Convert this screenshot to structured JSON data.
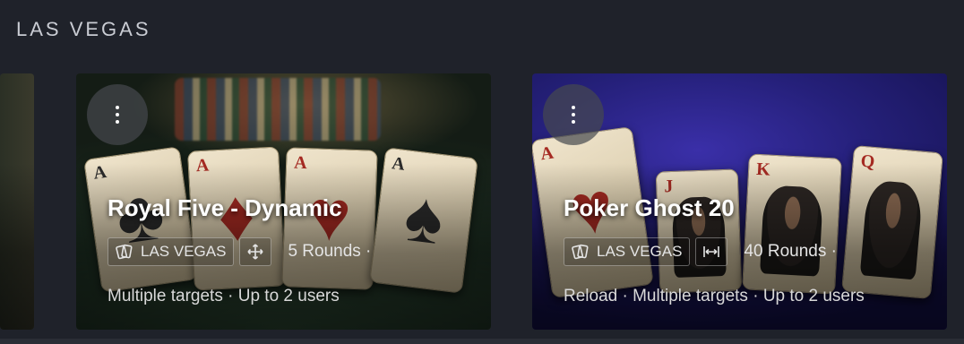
{
  "section": {
    "title": "LAS VEGAS"
  },
  "cards": [
    {
      "title": "Royal Five - Dynamic",
      "location": "LAS VEGAS",
      "mode_icon": "move-arrows-icon",
      "rounds": "5 Rounds ·",
      "features": "Multiple targets · Up to 2 users",
      "artwork_cards": [
        {
          "rank": "A",
          "suit": "♣",
          "color": "black"
        },
        {
          "rank": "A",
          "suit": "♦",
          "color": "red"
        },
        {
          "rank": "A",
          "suit": "♥",
          "color": "red"
        },
        {
          "rank": "A",
          "suit": "♠",
          "color": "black"
        }
      ]
    },
    {
      "title": "Poker Ghost 20",
      "location": "LAS VEGAS",
      "mode_icon": "horizontal-range-icon",
      "rounds": "40 Rounds ·",
      "features": "Reload · Multiple targets · Up to 2 users",
      "artwork_cards": [
        {
          "rank": "A",
          "suit": "♥",
          "color": "red"
        },
        {
          "rank": "J",
          "suit": "♥",
          "color": "red"
        },
        {
          "rank": "K",
          "suit": "♥",
          "color": "red"
        },
        {
          "rank": "Q",
          "suit": "♥",
          "color": "red"
        }
      ]
    }
  ]
}
